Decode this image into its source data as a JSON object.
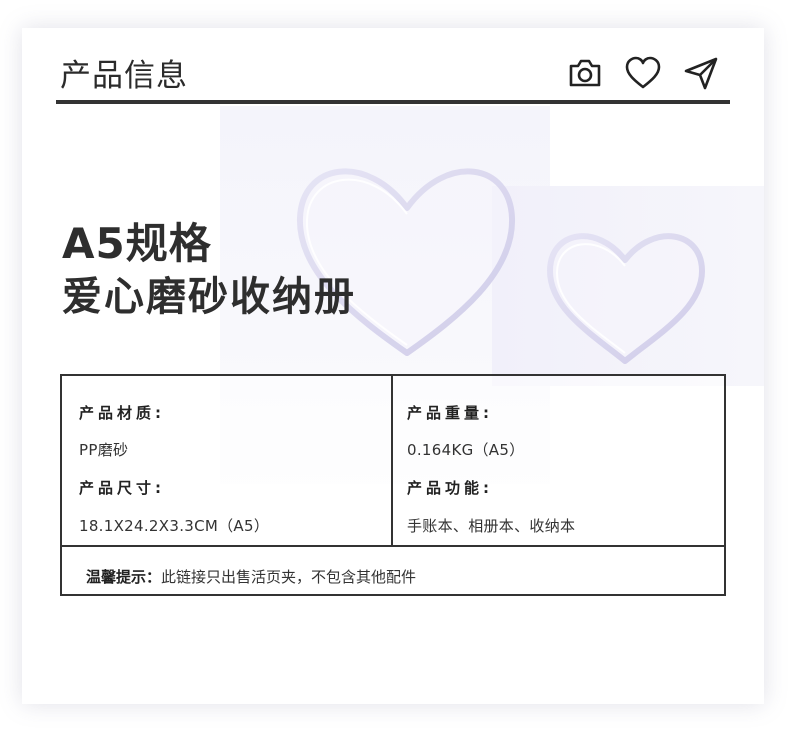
{
  "header": {
    "title": "产品信息",
    "icons": [
      "camera-icon",
      "heart-icon",
      "send-icon"
    ]
  },
  "hero": {
    "line1": "A5规格",
    "line2": "爱心磨砂收纳册"
  },
  "specs": {
    "material_label": "产品材质:",
    "material_value": "PP磨砂",
    "size_label": "产品尺寸:",
    "size_value": "18.1X24.2X3.3CM（A5）",
    "weight_label": "产品重量:",
    "weight_value": "0.164KG（A5）",
    "function_label": "产品功能:",
    "function_value": "手账本、相册本、收纳本"
  },
  "tip": {
    "label": "温馨提示：",
    "text": "此链接只出售活页夹，不包含其他配件"
  },
  "colors": {
    "text_dark": "#2e2e2e",
    "border": "#333333",
    "heart_tint": "#cfcce8"
  }
}
